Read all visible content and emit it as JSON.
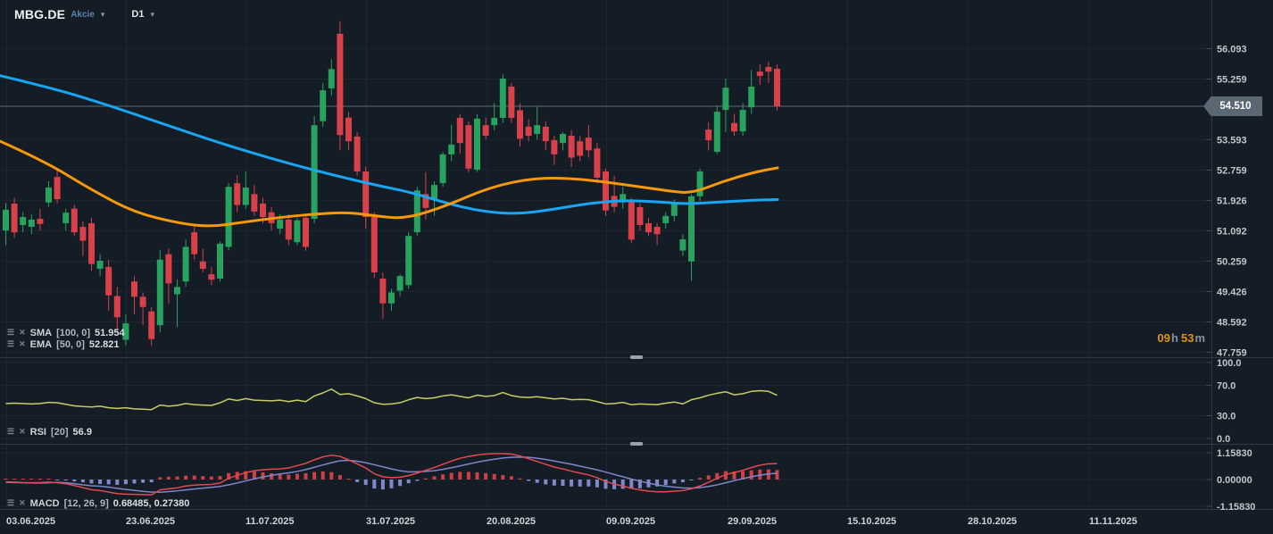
{
  "header": {
    "symbol": "MBG.DE",
    "instrument_type": "Akcie",
    "timeframe": "D1"
  },
  "countdown": {
    "hours": "09",
    "hours_unit": "h",
    "minutes": "53",
    "minutes_unit": "m"
  },
  "indicators": {
    "sma": {
      "name": "SMA",
      "params": "[100, 0]",
      "value": "51.954"
    },
    "ema": {
      "name": "EMA",
      "params": "[50, 0]",
      "value": "52.821"
    },
    "rsi": {
      "name": "RSI",
      "params": "[20]",
      "value": "56.9"
    },
    "macd": {
      "name": "MACD",
      "params": "[12, 26, 9]",
      "value": "0.68485,  0.27380"
    }
  },
  "price_axis": {
    "tick_labels": [
      "56.093",
      "55.259",
      "53.593",
      "52.759",
      "51.926",
      "51.092",
      "50.259",
      "49.426",
      "48.592",
      "47.759"
    ],
    "tick_values": [
      56.093,
      55.259,
      53.593,
      52.759,
      51.926,
      51.092,
      50.259,
      49.426,
      48.592,
      47.759
    ],
    "current_label": "54.510",
    "current_value": 54.51
  },
  "rsi_axis": {
    "tick_labels": [
      "100.0",
      "70.0",
      "30.0",
      "0.0"
    ],
    "tick_values": [
      100,
      70,
      30,
      0
    ]
  },
  "macd_axis": {
    "tick_labels": [
      "1.15830",
      "0.00000",
      "-1.15830"
    ],
    "tick_values": [
      1.1583,
      0,
      -1.1583
    ]
  },
  "date_axis": [
    "03.06.2025",
    "23.06.2025",
    "11.07.2025",
    "31.07.2025",
    "20.08.2025",
    "09.09.2025",
    "29.09.2025",
    "15.10.2025",
    "28.10.2025",
    "11.11.2025"
  ],
  "colors": {
    "background": "#141c25",
    "grid": "#1d2731",
    "separator": "#2d3a46",
    "handle": "#9aa3ab",
    "up": "#27a35f",
    "down": "#d8414a",
    "sma": "#19a5f2",
    "ema": "#f6980d",
    "rsi": "#c8cd63",
    "macd_line": "#e14a50",
    "macd_signal": "#7d86c9",
    "hist_pos": "#cf4046",
    "hist_neg": "#8089cb",
    "current_line": "#5d6c79",
    "current_tag_bg": "#5a6874",
    "axis_text": "#bfc7cd",
    "date_text": "#ccd3d9",
    "countdown_accent": "#e8930c"
  },
  "chart_data": {
    "type": "candlestick",
    "symbol": "MBG.DE",
    "timeframe": "D1",
    "price_range_visible": [
      47.759,
      56.093
    ],
    "x_range_visible": [
      "03.06.2025",
      "11.11.2025"
    ],
    "candles": [
      [
        51.1,
        51.85,
        50.7,
        51.67
      ],
      [
        51.84,
        52.0,
        50.9,
        51.05
      ],
      [
        51.25,
        51.6,
        51.05,
        51.47
      ],
      [
        51.2,
        51.55,
        51.0,
        51.4
      ],
      [
        51.42,
        51.7,
        51.1,
        51.28
      ],
      [
        51.87,
        52.45,
        51.75,
        52.28
      ],
      [
        52.57,
        52.79,
        51.85,
        51.96
      ],
      [
        51.3,
        51.7,
        51.1,
        51.59
      ],
      [
        51.7,
        51.8,
        50.95,
        51.05
      ],
      [
        51.2,
        51.35,
        50.4,
        50.82
      ],
      [
        51.3,
        51.45,
        50.0,
        50.18
      ],
      [
        50.05,
        50.45,
        49.85,
        50.27
      ],
      [
        50.1,
        50.3,
        48.9,
        49.32
      ],
      [
        49.3,
        49.55,
        48.35,
        48.72
      ],
      [
        48.1,
        48.8,
        47.95,
        48.55
      ],
      [
        49.7,
        49.85,
        48.8,
        49.28
      ],
      [
        49.28,
        49.4,
        48.5,
        49.0
      ],
      [
        48.88,
        49.0,
        47.94,
        48.12
      ],
      [
        48.5,
        50.57,
        48.3,
        50.3
      ],
      [
        50.45,
        50.6,
        49.1,
        49.65
      ],
      [
        49.35,
        49.75,
        48.45,
        49.55
      ],
      [
        49.7,
        50.85,
        49.55,
        50.65
      ],
      [
        51.05,
        51.2,
        50.3,
        50.45
      ],
      [
        50.25,
        50.6,
        49.95,
        50.05
      ],
      [
        49.9,
        50.1,
        49.6,
        49.75
      ],
      [
        49.78,
        50.8,
        49.7,
        50.74
      ],
      [
        50.65,
        52.4,
        50.55,
        52.3
      ],
      [
        52.4,
        52.62,
        51.6,
        51.8
      ],
      [
        51.8,
        52.72,
        51.7,
        52.28
      ],
      [
        52.1,
        52.35,
        51.5,
        51.62
      ],
      [
        51.84,
        52.0,
        51.3,
        51.47
      ],
      [
        51.6,
        51.75,
        51.1,
        51.3
      ],
      [
        51.15,
        51.55,
        51.0,
        51.4
      ],
      [
        51.4,
        51.55,
        50.7,
        50.85
      ],
      [
        50.78,
        51.45,
        50.7,
        51.38
      ],
      [
        51.45,
        51.55,
        50.55,
        50.65
      ],
      [
        51.42,
        54.24,
        51.3,
        53.99
      ],
      [
        54.1,
        55.15,
        53.95,
        54.95
      ],
      [
        55.0,
        55.8,
        54.8,
        55.53
      ],
      [
        56.5,
        56.85,
        53.3,
        53.72
      ],
      [
        54.2,
        54.35,
        53.3,
        53.55
      ],
      [
        53.68,
        53.8,
        52.6,
        52.72
      ],
      [
        52.72,
        52.85,
        51.15,
        51.47
      ],
      [
        51.47,
        51.6,
        49.8,
        49.95
      ],
      [
        49.78,
        49.95,
        48.68,
        49.1
      ],
      [
        49.1,
        49.5,
        48.9,
        49.4
      ],
      [
        49.45,
        49.9,
        49.3,
        49.85
      ],
      [
        49.6,
        51.05,
        49.5,
        50.95
      ],
      [
        51.05,
        52.3,
        50.95,
        52.2
      ],
      [
        52.1,
        52.7,
        51.4,
        51.72
      ],
      [
        51.96,
        52.45,
        51.5,
        52.35
      ],
      [
        52.4,
        53.25,
        52.3,
        53.19
      ],
      [
        53.19,
        54.0,
        53.0,
        53.46
      ],
      [
        54.19,
        54.3,
        53.2,
        53.5
      ],
      [
        53.99,
        54.1,
        52.7,
        52.8
      ],
      [
        52.77,
        54.3,
        52.7,
        54.17
      ],
      [
        53.99,
        54.2,
        53.6,
        53.7
      ],
      [
        53.99,
        54.6,
        53.85,
        54.19
      ],
      [
        54.19,
        55.39,
        54.05,
        55.27
      ],
      [
        55.05,
        55.15,
        54.05,
        54.19
      ],
      [
        54.4,
        54.6,
        53.4,
        53.62
      ],
      [
        53.95,
        54.15,
        53.55,
        53.7
      ],
      [
        53.75,
        54.49,
        53.6,
        53.99
      ],
      [
        53.95,
        54.1,
        53.3,
        53.55
      ],
      [
        53.58,
        53.7,
        52.9,
        53.19
      ],
      [
        53.5,
        53.8,
        53.3,
        53.75
      ],
      [
        53.7,
        53.85,
        52.84,
        53.1
      ],
      [
        53.55,
        53.7,
        53.0,
        53.15
      ],
      [
        53.65,
        54.0,
        53.1,
        53.3
      ],
      [
        53.35,
        53.5,
        52.4,
        52.55
      ],
      [
        52.72,
        52.8,
        51.5,
        51.65
      ],
      [
        52.05,
        52.6,
        51.6,
        51.75
      ],
      [
        51.87,
        52.3,
        51.7,
        52.1
      ],
      [
        51.9,
        52.0,
        50.75,
        50.85
      ],
      [
        51.74,
        51.85,
        51.1,
        51.25
      ],
      [
        51.3,
        51.45,
        50.95,
        51.05
      ],
      [
        51.2,
        51.3,
        50.7,
        51.0
      ],
      [
        51.3,
        51.6,
        51.15,
        51.5
      ],
      [
        51.5,
        51.95,
        51.35,
        51.84
      ],
      [
        50.55,
        51.0,
        50.4,
        50.86
      ],
      [
        50.25,
        52.1,
        49.72,
        52.04
      ],
      [
        52.04,
        52.8,
        51.9,
        52.72
      ],
      [
        53.87,
        54.07,
        53.3,
        53.58
      ],
      [
        53.26,
        54.53,
        53.2,
        54.36
      ],
      [
        54.41,
        55.27,
        53.8,
        55.02
      ],
      [
        54.05,
        54.3,
        53.7,
        53.82
      ],
      [
        53.82,
        54.6,
        53.7,
        54.41
      ],
      [
        54.48,
        55.51,
        54.3,
        55.05
      ],
      [
        55.46,
        55.66,
        55.1,
        55.34
      ],
      [
        55.59,
        55.73,
        55.15,
        55.46
      ],
      [
        55.54,
        55.66,
        54.4,
        54.51
      ]
    ],
    "overlays": {
      "sma_100": [
        [
          0,
          55.35
        ],
        [
          60,
          55.0
        ],
        [
          120,
          54.55
        ],
        [
          180,
          54.05
        ],
        [
          240,
          53.55
        ],
        [
          300,
          53.1
        ],
        [
          360,
          52.7
        ],
        [
          420,
          52.35
        ],
        [
          460,
          52.15
        ],
        [
          500,
          51.85
        ],
        [
          540,
          51.62
        ],
        [
          580,
          51.55
        ],
        [
          620,
          51.68
        ],
        [
          660,
          51.85
        ],
        [
          700,
          51.93
        ],
        [
          740,
          51.88
        ],
        [
          770,
          51.83
        ],
        [
          800,
          51.87
        ],
        [
          840,
          51.93
        ],
        [
          871,
          51.95
        ]
      ],
      "ema_50": [
        [
          0,
          53.55
        ],
        [
          50,
          53.0
        ],
        [
          100,
          52.25
        ],
        [
          150,
          51.6
        ],
        [
          200,
          51.3
        ],
        [
          235,
          51.2
        ],
        [
          270,
          51.32
        ],
        [
          310,
          51.45
        ],
        [
          350,
          51.55
        ],
        [
          390,
          51.6
        ],
        [
          420,
          51.5
        ],
        [
          455,
          51.42
        ],
        [
          500,
          51.78
        ],
        [
          550,
          52.3
        ],
        [
          600,
          52.55
        ],
        [
          650,
          52.52
        ],
        [
          700,
          52.36
        ],
        [
          750,
          52.18
        ],
        [
          775,
          52.12
        ],
        [
          810,
          52.45
        ],
        [
          845,
          52.7
        ],
        [
          871,
          52.82
        ]
      ]
    },
    "rsi_20": [
      46,
      46.5,
      46,
      45.5,
      46,
      47.5,
      47,
      45,
      43,
      42,
      41.5,
      42.5,
      40.5,
      39.5,
      40.5,
      39,
      38.5,
      38,
      44,
      42.5,
      43.5,
      46,
      44.5,
      44,
      43.5,
      47,
      52,
      50,
      52.5,
      50.5,
      50,
      49.5,
      50.5,
      48.5,
      50.5,
      48.5,
      56,
      60,
      65,
      58,
      59,
      56,
      52.5,
      47,
      45,
      45.5,
      47,
      51,
      54,
      52.5,
      53.5,
      56,
      57.5,
      55.5,
      53.5,
      57,
      55.5,
      56.5,
      60.5,
      56.5,
      54.5,
      54,
      55,
      53.5,
      52,
      53,
      51,
      51.5,
      51,
      48.5,
      45.5,
      46,
      47.5,
      44.5,
      45.5,
      45,
      44.5,
      46.5,
      48,
      45.5,
      51,
      53.5,
      57,
      59.5,
      61.5,
      57.5,
      59,
      62,
      63,
      62,
      56.9
    ],
    "macd": {
      "macd_line": [
        -0.1,
        -0.11,
        -0.13,
        -0.14,
        -0.13,
        -0.11,
        -0.14,
        -0.18,
        -0.26,
        -0.35,
        -0.44,
        -0.48,
        -0.54,
        -0.61,
        -0.63,
        -0.64,
        -0.65,
        -0.66,
        -0.45,
        -0.4,
        -0.36,
        -0.28,
        -0.24,
        -0.22,
        -0.21,
        -0.15,
        0.05,
        0.18,
        0.3,
        0.38,
        0.42,
        0.45,
        0.46,
        0.5,
        0.6,
        0.7,
        0.85,
        0.98,
        1.05,
        1.0,
        0.85,
        0.68,
        0.5,
        0.25,
        0.12,
        0.08,
        0.1,
        0.17,
        0.28,
        0.4,
        0.52,
        0.66,
        0.8,
        0.92,
        1.0,
        1.06,
        1.1,
        1.12,
        1.12,
        1.1,
        1.02,
        0.9,
        0.78,
        0.66,
        0.54,
        0.46,
        0.36,
        0.28,
        0.2,
        0.08,
        -0.08,
        -0.2,
        -0.28,
        -0.38,
        -0.45,
        -0.5,
        -0.53,
        -0.53,
        -0.5,
        -0.48,
        -0.4,
        -0.28,
        -0.12,
        0.05,
        0.22,
        0.3,
        0.4,
        0.52,
        0.62,
        0.68,
        0.685
      ],
      "signal_line": [
        -0.12,
        -0.13,
        -0.14,
        -0.15,
        -0.15,
        -0.14,
        -0.12,
        -0.14,
        -0.18,
        -0.23,
        -0.27,
        -0.29,
        -0.33,
        -0.38,
        -0.43,
        -0.47,
        -0.51,
        -0.54,
        -0.55,
        -0.52,
        -0.49,
        -0.45,
        -0.41,
        -0.37,
        -0.34,
        -0.3,
        -0.23,
        -0.15,
        -0.06,
        0.03,
        0.11,
        0.18,
        0.24,
        0.29,
        0.35,
        0.43,
        0.53,
        0.63,
        0.73,
        0.81,
        0.83,
        0.79,
        0.73,
        0.64,
        0.55,
        0.46,
        0.38,
        0.33,
        0.34,
        0.35,
        0.38,
        0.44,
        0.51,
        0.59,
        0.67,
        0.75,
        0.82,
        0.88,
        0.93,
        0.96,
        0.97,
        0.96,
        0.92,
        0.87,
        0.8,
        0.73,
        0.66,
        0.58,
        0.5,
        0.42,
        0.32,
        0.22,
        0.12,
        0.02,
        -0.07,
        -0.16,
        -0.23,
        -0.29,
        -0.33,
        -0.36,
        -0.37,
        -0.35,
        -0.3,
        -0.23,
        -0.14,
        -0.05,
        0.04,
        0.12,
        0.19,
        0.24,
        0.274
      ]
    }
  }
}
